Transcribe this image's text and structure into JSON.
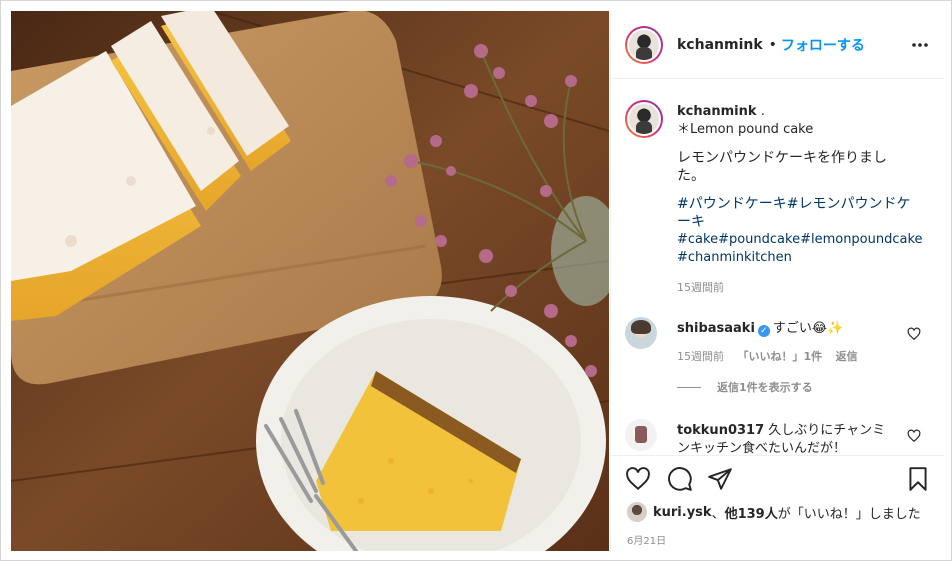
{
  "post": {
    "username": "kchanmink",
    "separator": "•",
    "follow_label": "フォローする",
    "more_icon": "more-horizontal-icon"
  },
  "caption": {
    "username": "kchanmink",
    "dot": ".",
    "title": "＊Lemon pound cake",
    "text": "レモンパウンドケーキを作りました。",
    "hashtags_line1": "#パウンドケーキ#レモンパウンドケ",
    "hashtags_line2": "ーキ",
    "hashtags_line3": "#cake#poundcake#lemonpoundcake",
    "hashtags_line4": "#chanminkitchen",
    "time": "15週間前"
  },
  "comments": [
    {
      "username": "shibasaaki",
      "text": "すごい😂✨",
      "time": "15週間前",
      "likes": "「いいね！」1件",
      "reply": "返信",
      "view_replies": "返信1件を表示する"
    },
    {
      "username": "tokkun0317",
      "text": "久しぶりにチャンミ",
      "text2": "ンキッチン食べたいんだが！"
    }
  ],
  "actions": {
    "liked_user": "kuri.ysk",
    "liked_sep": "、",
    "liked_others": "他139人",
    "liked_suffix": "が「いいね！」しました",
    "date": "6月21日"
  },
  "colors": {
    "link_blue": "#0095f6",
    "hashtag": "#00376b",
    "muted": "#8e8e8e",
    "text": "#262626"
  }
}
